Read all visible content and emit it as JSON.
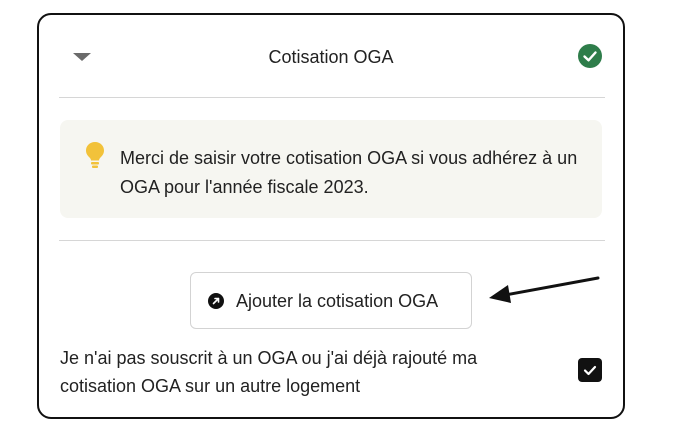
{
  "section": {
    "title": "Cotisation OGA",
    "status": "completed"
  },
  "info": {
    "icon": "lightbulb-icon",
    "text": "Merci de saisir votre cotisation OGA si vous adhérez à un OGA pour l'année fiscale 2023."
  },
  "actions": {
    "add_label": "Ajouter la cotisation OGA",
    "add_icon": "arrow-up-right-circle-icon"
  },
  "option": {
    "label": "Je n'ai pas souscrit à un OGA ou j'ai déjà rajouté ma cotisation OGA sur un autre logement",
    "checked": true
  },
  "colors": {
    "success": "#2e7d4a",
    "bulb": "#f2c23a",
    "info_bg": "#f6f6f1",
    "border": "#111111"
  }
}
